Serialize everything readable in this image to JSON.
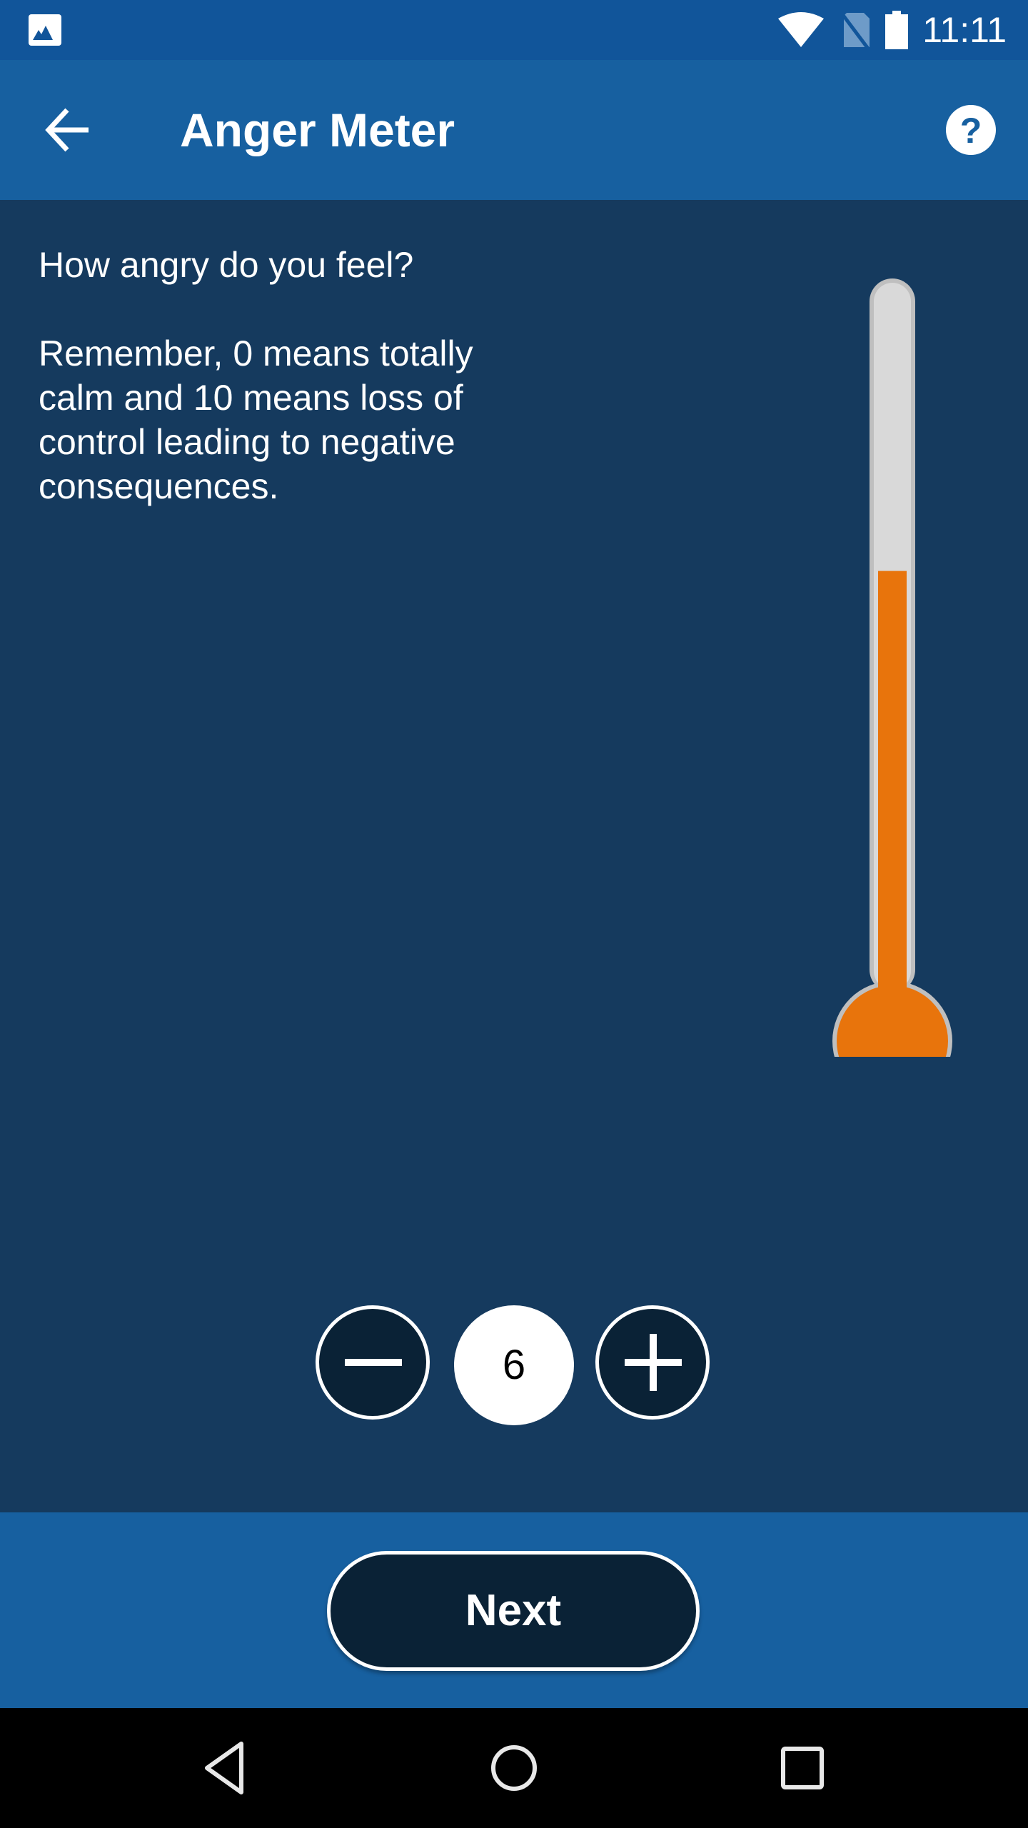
{
  "status_bar": {
    "time": "11:11",
    "icons": [
      "image-notification-icon",
      "wifi-icon",
      "no-sim-icon",
      "battery-icon"
    ]
  },
  "app_bar": {
    "title": "Anger Meter",
    "back_icon": "arrow-left-icon",
    "help_icon": "help-circle-icon"
  },
  "content": {
    "question": "How angry do you feel?",
    "explanation": "Remember, 0 means totally calm and 10 means loss of control leading to negative consequences."
  },
  "meter": {
    "value": 6,
    "min": 0,
    "max": 10,
    "fill_color": "#E8740C",
    "tube_color": "#D9D9D9",
    "border_color": "#BFBFBF"
  },
  "stepper": {
    "value": "6",
    "decrement_icon": "minus-icon",
    "increment_icon": "plus-icon"
  },
  "footer": {
    "next_label": "Next"
  },
  "nav_bar": {
    "icons": [
      "nav-back-icon",
      "nav-home-icon",
      "nav-recents-icon"
    ]
  },
  "colors": {
    "status_bar": "#11559A",
    "app_bar": "#1760A0",
    "content_bg": "#153A5E",
    "button_dark": "#0A2236",
    "accent_orange": "#E8740C"
  }
}
